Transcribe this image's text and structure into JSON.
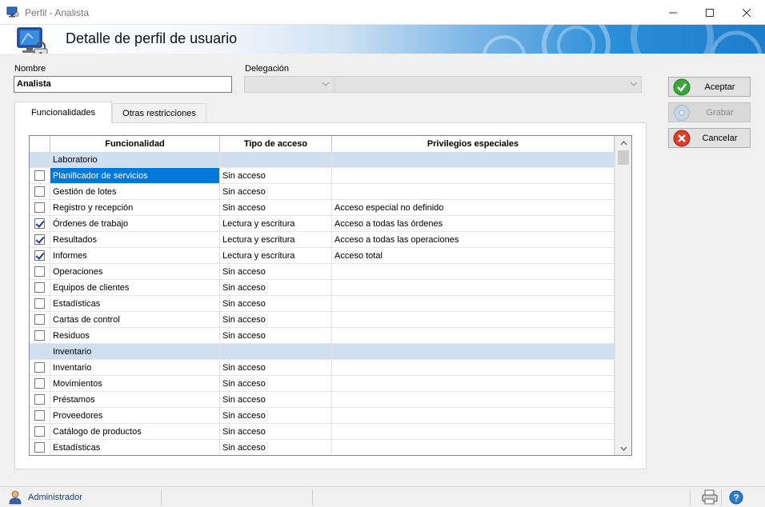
{
  "window": {
    "title": "Perfil - Analista",
    "app_icon": "monitor-user-icon",
    "controls": [
      "minimize-icon",
      "maximize-icon",
      "close-icon"
    ]
  },
  "header": {
    "title": "Detalle de perfil de usuario",
    "icon": "monitor-lock-icon"
  },
  "form": {
    "nombre_label": "Nombre",
    "nombre_value": "Analista",
    "delegacion_label": "Delegación",
    "delegacion_code": "",
    "delegacion_name": ""
  },
  "actions": {
    "aceptar": "Aceptar",
    "grabar": "Grabar",
    "cancelar": "Cancelar"
  },
  "tabs": [
    {
      "label": "Funcionalidades",
      "active": true
    },
    {
      "label": "Otras restricciones",
      "active": false
    }
  ],
  "grid": {
    "columns": [
      "Funcionalidad",
      "Tipo de acceso",
      "Privilegios especiales"
    ],
    "rows": [
      {
        "group": true,
        "checked": false,
        "name": "Laboratorio",
        "access": "",
        "privileges": ""
      },
      {
        "group": false,
        "checked": false,
        "name": "Planificador de servicios",
        "access": "Sin acceso",
        "privileges": "",
        "selected": true
      },
      {
        "group": false,
        "checked": false,
        "name": "Gestión de lotes",
        "access": "Sin acceso",
        "privileges": ""
      },
      {
        "group": false,
        "checked": false,
        "name": "Registro y recepción",
        "access": "Sin acceso",
        "privileges": "Acceso especial no definido"
      },
      {
        "group": false,
        "checked": true,
        "name": "Órdenes de trabajo",
        "access": "Lectura y escritura",
        "privileges": "Acceso a todas las órdenes"
      },
      {
        "group": false,
        "checked": true,
        "name": "Resultados",
        "access": "Lectura y escritura",
        "privileges": "Acceso a todas las operaciones"
      },
      {
        "group": false,
        "checked": true,
        "name": "Informes",
        "access": "Lectura y escritura",
        "privileges": "Acceso total"
      },
      {
        "group": false,
        "checked": false,
        "name": "Operaciones",
        "access": "Sin acceso",
        "privileges": ""
      },
      {
        "group": false,
        "checked": false,
        "name": "Equipos de clientes",
        "access": "Sin acceso",
        "privileges": ""
      },
      {
        "group": false,
        "checked": false,
        "name": "Estadísticas",
        "access": "Sin acceso",
        "privileges": ""
      },
      {
        "group": false,
        "checked": false,
        "name": "Cartas de control",
        "access": "Sin acceso",
        "privileges": ""
      },
      {
        "group": false,
        "checked": false,
        "name": "Residuos",
        "access": "Sin acceso",
        "privileges": ""
      },
      {
        "group": true,
        "checked": false,
        "name": "Inventario",
        "access": "",
        "privileges": ""
      },
      {
        "group": false,
        "checked": false,
        "name": "Inventario",
        "access": "Sin acceso",
        "privileges": ""
      },
      {
        "group": false,
        "checked": false,
        "name": "Movimientos",
        "access": "Sin acceso",
        "privileges": ""
      },
      {
        "group": false,
        "checked": false,
        "name": "Préstamos",
        "access": "Sin acceso",
        "privileges": ""
      },
      {
        "group": false,
        "checked": false,
        "name": "Proveedores",
        "access": "Sin acceso",
        "privileges": ""
      },
      {
        "group": false,
        "checked": false,
        "name": "Catálogo de productos",
        "access": "Sin acceso",
        "privileges": ""
      },
      {
        "group": false,
        "checked": false,
        "name": "Estadísticas",
        "access": "Sin acceso",
        "privileges": ""
      }
    ]
  },
  "status": {
    "user": "Administrador",
    "icons": [
      "user-icon",
      "printer-icon",
      "help-icon"
    ]
  },
  "colors": {
    "selection": "#0078d7",
    "group_row": "#cfdff0",
    "banner_blue": "#1d7dcc"
  }
}
